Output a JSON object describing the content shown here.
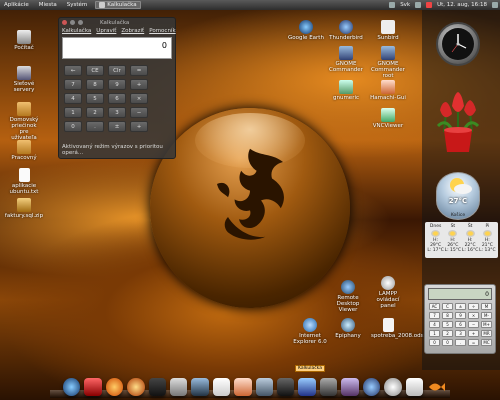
{
  "top_panel": {
    "menus": [
      "Aplikácie",
      "Miesta",
      "Systém"
    ],
    "task": "Kalkulačka",
    "user": "Svk",
    "datetime": "Ut, 12. aug, 16:18"
  },
  "desktop_icons_left": [
    {
      "label": "Počítač"
    },
    {
      "label": "Sieťové servery"
    },
    {
      "label": "Domovský priečinok pre užívateľa"
    },
    {
      "label": "Pracovný"
    },
    {
      "label": "aplikacie ubuntu.txt"
    },
    {
      "label": "faktury.sql.zip"
    }
  ],
  "desktop_icons_right": [
    {
      "label": "Google Earth"
    },
    {
      "label": "Thunderbird"
    },
    {
      "label": "Sunbird"
    },
    {
      "label": "GNOME Commander"
    },
    {
      "label": "GNOME Commander root"
    },
    {
      "label": "gnumeric"
    },
    {
      "label": "Hamachi-Gui"
    },
    {
      "label": "VNCViewer"
    },
    {
      "label": "Remote Desktop Viewer"
    },
    {
      "label": "LAMPP ovládací panel"
    },
    {
      "label": "Internet Explorer 6.0"
    },
    {
      "label": "Epiphany"
    },
    {
      "label": "spotreba_2008.ods"
    }
  ],
  "calculator": {
    "title": "Kalkulačka",
    "menu": [
      "Kalkulačka",
      "Upraviť",
      "Zobraziť",
      "Pomocník"
    ],
    "display": "0",
    "keys": [
      "←",
      "CE",
      "Clr",
      "=",
      "",
      "7",
      "8",
      "9",
      "+",
      "",
      "4",
      "5",
      "6",
      "×",
      "",
      "1",
      "2",
      "3",
      "−",
      "",
      "0",
      ".",
      "±",
      "+",
      ""
    ],
    "status": "Aktivovaný režim výrazov s prioritou operá..."
  },
  "weather": {
    "temperature": "27°C",
    "city": "Košice",
    "forecast": [
      {
        "day": "Dnes",
        "hi": "H: 29°C",
        "lo": "L: 17°C"
      },
      {
        "day": "St",
        "hi": "H: 26°C",
        "lo": "L: 15°C"
      },
      {
        "day": "Št",
        "hi": "H: 22°C",
        "lo": "L: 16°C"
      },
      {
        "day": "Pi",
        "hi": "H: 21°C",
        "lo": "L: 13°C"
      }
    ]
  },
  "mini_calc": {
    "display": "0",
    "keys": [
      "AC",
      "C",
      "±",
      "÷",
      "M",
      "7",
      "8",
      "9",
      "×",
      "M-",
      "4",
      "5",
      "6",
      "−",
      "M+",
      "1",
      "2",
      "3",
      "+",
      "MR",
      "0",
      "0",
      ".",
      "=",
      "MC"
    ]
  },
  "dock": {
    "tooltip": "Kalkulačka",
    "icons": [
      "google-earth-icon",
      "tv-icon",
      "firefox-icon",
      "firefox-alt-icon",
      "terminal-icon",
      "calculator-icon",
      "network-icon",
      "text-editor-icon",
      "hamachi-icon",
      "display-icon",
      "screensaver-icon",
      "email-icon",
      "shredder-icon",
      "pidgin-icon",
      "thunderbird-icon",
      "clock-icon",
      "document-icon",
      "fish-icon"
    ]
  }
}
